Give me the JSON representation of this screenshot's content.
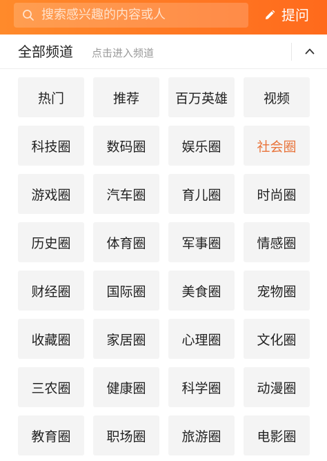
{
  "header": {
    "search_placeholder": "搜索感兴趣的内容或人",
    "search_icon": "search-icon",
    "ask_label": "提问",
    "ask_icon": "pencil-icon",
    "accent_color": "#ff7a23"
  },
  "section": {
    "title": "全部频道",
    "hint": "点击进入频道",
    "collapse_icon": "chevron-up-icon"
  },
  "channels": [
    {
      "label": "热门"
    },
    {
      "label": "推荐"
    },
    {
      "label": "百万英雄"
    },
    {
      "label": "视频"
    },
    {
      "label": "科技圈"
    },
    {
      "label": "数码圈"
    },
    {
      "label": "娱乐圈"
    },
    {
      "label": "社会圈",
      "active": true
    },
    {
      "label": "游戏圈"
    },
    {
      "label": "汽车圈"
    },
    {
      "label": "育儿圈"
    },
    {
      "label": "时尚圈"
    },
    {
      "label": "历史圈"
    },
    {
      "label": "体育圈"
    },
    {
      "label": "军事圈"
    },
    {
      "label": "情感圈"
    },
    {
      "label": "财经圈"
    },
    {
      "label": "国际圈"
    },
    {
      "label": "美食圈"
    },
    {
      "label": "宠物圈"
    },
    {
      "label": "收藏圈"
    },
    {
      "label": "家居圈"
    },
    {
      "label": "心理圈"
    },
    {
      "label": "文化圈"
    },
    {
      "label": "三农圈"
    },
    {
      "label": "健康圈"
    },
    {
      "label": "科学圈"
    },
    {
      "label": "动漫圈"
    },
    {
      "label": "教育圈"
    },
    {
      "label": "职场圈"
    },
    {
      "label": "旅游圈"
    },
    {
      "label": "电影圈"
    }
  ],
  "colors": {
    "chip_bg": "#f4f4f4",
    "active_text": "#e8743b"
  }
}
